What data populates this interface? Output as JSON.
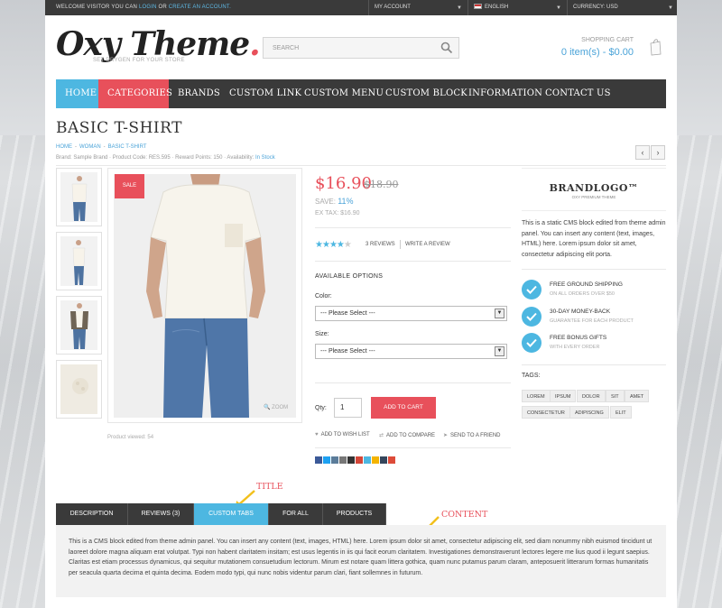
{
  "topbar": {
    "welcome_prefix": "WELCOME VISITOR YOU CAN",
    "login": "LOGIN",
    "or": "OR",
    "create_account": "CREATE AN ACCOUNT.",
    "my_account": "MY ACCOUNT",
    "language": "ENGLISH",
    "currency": "CURRENCY: USD"
  },
  "header": {
    "logo_text": "Oxy Theme",
    "logo_dot": ".",
    "tagline": "SET DRYGEN FOR YOUR STORE",
    "search_placeholder": "SEARCH",
    "cart_label": "SHOPPING CART",
    "cart_value": "0 item(s) - $0.00"
  },
  "nav": [
    "HOME",
    "CATEGORIES",
    "BRANDS",
    "CUSTOM LINK",
    "CUSTOM MENU",
    "CUSTOM BLOCK",
    "INFORMATION",
    "CONTACT US"
  ],
  "product": {
    "title": "BASIC T-SHIRT",
    "breadcrumb": [
      "HOME",
      "WOMAN",
      "BASIC T-SHIRT"
    ],
    "meta": "Brand: Sample Brand  ·  Product Code: RES.595  ·  Reward Points: 150  ·  Availability:",
    "availability": "In Stock",
    "sale_badge": "SALE",
    "zoom": "ZOOM",
    "viewed": "Product viewed: 54",
    "price": "$16.90",
    "old_price": "$18.90",
    "save_label": "SAVE:",
    "save_value": "11%",
    "ex_tax": "EX TAX: $16.90",
    "rating": 4,
    "reviews_link": "3 REVIEWS",
    "write_review": "WRITE A REVIEW",
    "options_heading": "AVAILABLE OPTIONS",
    "color_label": "Color:",
    "color_value": "--- Please Select ---",
    "size_label": "Size:",
    "size_value": "--- Please Select ---",
    "qty_label": "Qty:",
    "qty_value": "1",
    "add_to_cart": "ADD TO CART",
    "wishlist": "ADD TO WISH LIST",
    "compare": "ADD TO COMPARE",
    "send_friend": "SEND TO A FRIEND",
    "share_colors": [
      "#3b5998",
      "#1da1f2",
      "#5b7c9a",
      "#777777",
      "#333333",
      "#d44638",
      "#4db7e1",
      "#f4b400",
      "#35465c",
      "#dd4b39"
    ]
  },
  "sidebar": {
    "brand_logo": "BRANDLOGO™",
    "brand_sub": "OXY PREMIUM THEME",
    "cms_text": "This is a static CMS block edited from theme admin panel. You can insert any content (text, images, HTML) here. Lorem ipsum dolor sit amet, consectetur adipiscing elit porta.",
    "perks": [
      {
        "title": "FREE GROUND SHIPPING",
        "sub": "ON ALL ORDERS OVER $50"
      },
      {
        "title": "30-DAY MONEY-BACK",
        "sub": "GUARANTEE FOR EACH PRODUCT"
      },
      {
        "title": "FREE BONUS GIFTS",
        "sub": "WITH EVERY ORDER"
      }
    ],
    "tags_heading": "TAGS:",
    "tags": [
      "LOREM",
      "IPSUM",
      "DOLOR",
      "SIT",
      "AMET",
      "CONSECTETUR",
      "ADIPISCING",
      "ELIT"
    ]
  },
  "tabs": [
    "DESCRIPTION",
    "REVIEWS (3)",
    "CUSTOM TABS",
    "FOR ALL",
    "PRODUCTS"
  ],
  "tab_content": "This is a CMS block edited from theme admin panel. You can insert any content (text, images, HTML) here. Lorem ipsum dolor sit amet, consectetur adipiscing elit, sed diam nonummy nibh euismod tincidunt ut laoreet dolore magna aliquam erat volutpat. Typi non habent claritatem insitam; est usus legentis in iis qui facit eorum claritatem. Investigationes demonstraverunt lectores legere me lius quod ii legunt saepius. Claritas est etiam processus dynamicus, qui sequitur mutationem consuetudium lectorum. Mirum est notare quam littera gothica, quam nunc putamus parum claram, anteposuerit litterarum formas humanitatis per seacula quarta decima et quinta decima. Eodem modo typi, qui nunc nobis videntur parum clari, fiant sollemnes in futurum.",
  "annotations": {
    "title": "TITLE",
    "content": "CONTENT"
  },
  "colors": {
    "accent_blue": "#4db7e1",
    "accent_red": "#e8505b",
    "dark": "#3a3a3a"
  }
}
